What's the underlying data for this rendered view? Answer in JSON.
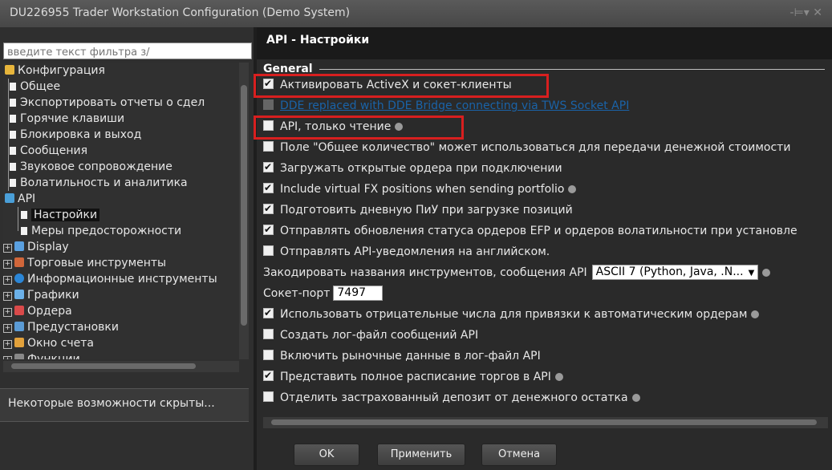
{
  "window": {
    "title": "DU226955 Trader Workstation Configuration (Demo System)",
    "controls": "-⊨▾ ✕"
  },
  "left": {
    "filter_placeholder": "введите текст фильтра з/",
    "tree": [
      {
        "label": "Конфигурация",
        "kind": "folder"
      },
      {
        "label": "Общее",
        "kind": "doc"
      },
      {
        "label": "Экспортировать отчеты о сдел",
        "kind": "doc"
      },
      {
        "label": "Горячие клавиши",
        "kind": "doc"
      },
      {
        "label": "Блокировка и выход",
        "kind": "doc"
      },
      {
        "label": "Сообщения",
        "kind": "doc"
      },
      {
        "label": "Звуковое сопровождение",
        "kind": "doc"
      },
      {
        "label": "Волатильность и аналитика",
        "kind": "doc"
      },
      {
        "label": "API",
        "kind": "api"
      },
      {
        "label": "Настройки",
        "kind": "doc"
      },
      {
        "label": "Меры предосторожности",
        "kind": "doc"
      },
      {
        "label": "Display",
        "kind": "plus"
      },
      {
        "label": "Торговые инструменты",
        "kind": "plus"
      },
      {
        "label": "Информационные инструменты",
        "kind": "plus"
      },
      {
        "label": "Графики",
        "kind": "plus"
      },
      {
        "label": "Ордера",
        "kind": "plus"
      },
      {
        "label": "Предустановки",
        "kind": "plus"
      },
      {
        "label": "Окно счета",
        "kind": "plus"
      },
      {
        "label": "Функции",
        "kind": "plus"
      }
    ],
    "hidden_note": "Некоторые возможности скрыты..."
  },
  "right": {
    "header": "API - Настройки",
    "group_title": "General",
    "settings": [
      {
        "label": "Активировать ActiveX и сокет-клиенты",
        "checked": true,
        "info": false
      },
      {
        "label": "DDE replaced with DDE Bridge connecting via TWS Socket API",
        "checked": false,
        "info": false
      },
      {
        "label": "API, только чтение",
        "checked": false,
        "info": true
      },
      {
        "label": "Поле \"Общее количество\" может использоваться для передачи денежной стоимости",
        "checked": false,
        "info": false
      },
      {
        "label": "Загружать открытые ордера при подключении",
        "checked": true,
        "info": false
      },
      {
        "label": "Include virtual FX positions when sending portfolio",
        "checked": true,
        "info": true
      },
      {
        "label": "Подготовить дневную ПиУ при загрузке позиций",
        "checked": true,
        "info": false
      },
      {
        "label": "Отправлять обновления статуса ордеров EFP и ордеров волатильности при установле",
        "checked": true,
        "info": false
      },
      {
        "label": "Отправлять API-уведомления на английском.",
        "checked": false,
        "info": false
      }
    ],
    "encoding_label": "Закодировать названия инструментов, сообщения API",
    "encoding_value": "ASCII 7 (Python, Java, .N...",
    "port_label": "Сокет-порт",
    "port_value": "7497",
    "settings2": [
      {
        "label": "Использовать отрицательные числа для привязки к автоматическим ордерам",
        "checked": true,
        "info": true
      },
      {
        "label": "Создать лог-файл сообщений API",
        "checked": false,
        "info": false
      },
      {
        "label": "Включить рыночные данные в лог-файл API",
        "checked": false,
        "info": false
      },
      {
        "label": "Представить полное расписание торгов в API",
        "checked": true,
        "info": true
      },
      {
        "label": "Отделить застрахованный депозит от денежного остатка",
        "checked": false,
        "info": true
      }
    ]
  },
  "buttons": {
    "ok": "OK",
    "apply": "Применить",
    "cancel": "Отмена"
  },
  "colors": {
    "highlight": "#d81f1f",
    "link": "#1a63a8"
  }
}
